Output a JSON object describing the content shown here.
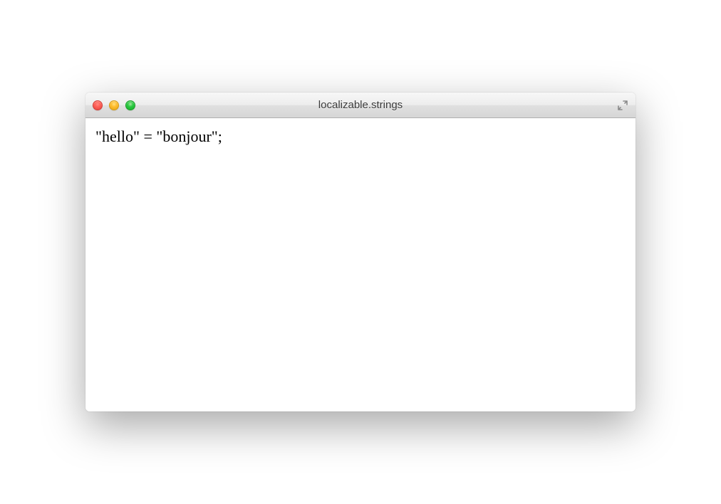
{
  "window": {
    "title": "localizable.strings"
  },
  "editor": {
    "content": "\"hello\" = \"bonjour\";"
  }
}
